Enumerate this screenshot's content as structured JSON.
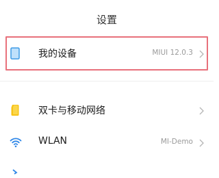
{
  "status_bar": {
    "left_text": "(partially visible)",
    "right_text": "(partially visible)"
  },
  "header": {
    "title": "设置"
  },
  "rows": [
    {
      "label": "我的设备",
      "value": "MIUI 12.0.3",
      "icon": "device-icon"
    },
    {
      "label": "双卡与移动网络",
      "value": "",
      "icon": "sim-card-icon"
    },
    {
      "label": "WLAN",
      "value": "MI-Demo",
      "icon": "wifi-icon"
    }
  ],
  "colors": {
    "highlight": "#e8707b",
    "sim_icon": "#f7c318",
    "wifi_icon": "#2f87e8",
    "device_icon": "#3f9be6"
  }
}
